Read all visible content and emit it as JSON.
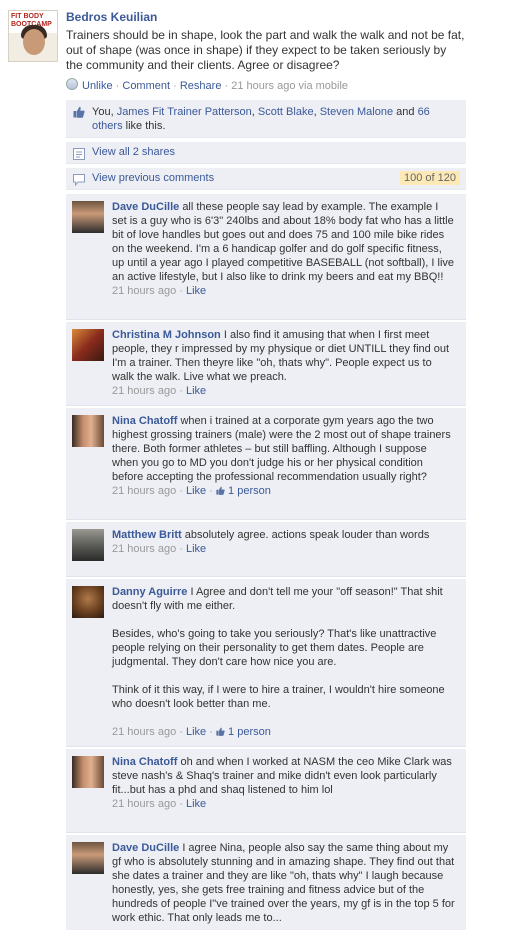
{
  "post": {
    "author": "Bedros Keuilian",
    "avatar_logo": "FIT BODY BOOTCAMP",
    "text": "Trainers should be in shape, look the part and walk the walk and not be fat, out of shape (was once in shape) if they expect to be taken seriously by the community and their clients. Agree or disagree?",
    "actions": {
      "unlike": "Unlike",
      "comment": "Comment",
      "reshare": "Reshare",
      "timestamp": "21 hours ago via mobile",
      "sep": "·"
    }
  },
  "likes": {
    "prefix": "You,",
    "people": [
      "James Fit Trainer Patterson",
      "Scott Blake",
      "Steven Malone"
    ],
    "and": "and",
    "others": "66 others",
    "suffix": "like this."
  },
  "shares": {
    "label": "View all 2 shares"
  },
  "previous": {
    "label": "View previous comments",
    "count": "100 of 120"
  },
  "comments": [
    {
      "author": "Dave DuCille",
      "text": "all these people say lead by example. The example I set is a guy who is 6'3\" 240lbs and about 18% body fat who has a little bit of love handles but goes out and does 75 and 100 mile bike rides on the weekend. I'm a 6 handicap golfer and do golf specific fitness, up until a year ago I played competitive BASEBALL (not softball), I live an active lifestyle, but I also like to drink my beers and eat my BBQ!!",
      "time": "21 hours ago",
      "like": "Like"
    },
    {
      "author": "Christina M Johnson",
      "text": "I also find it amusing that when I first meet people, they r impressed by my physique or diet UNTILL they find out I'm a trainer. Then theyre like \"oh, thats why\". People expect us to walk the walk. Live what we preach.",
      "time": "21 hours ago",
      "like": "Like"
    },
    {
      "author": "Nina Chatoff",
      "text": "when i trained at a corporate gym years ago the two highest grossing trainers (male) were the 2 most out of shape trainers there. Both former athletes – but still baffling. Although I suppose when you go to MD you don't judge his or her physical condition before accepting the professional recommendation usually right?",
      "time": "21 hours ago",
      "like": "Like",
      "likes": "1 person"
    },
    {
      "author": "Matthew Britt",
      "text": "absolutely agree. actions speak louder than words",
      "time": "21 hours ago",
      "like": "Like"
    },
    {
      "author": "Danny Aguirre",
      "text": "I Agree and don't tell me your \"off season!\" That shit doesn't fly with me either.",
      "text2": "Besides, who's going to take you seriously? That's like unattractive people relying on their personality to get them dates. People are judgmental. They don't care how nice you are.",
      "text3": "Think of it this way, if I were to hire a trainer, I wouldn't hire someone who doesn't look better than me.",
      "time": "21 hours ago",
      "like": "Like",
      "likes": "1 person"
    },
    {
      "author": "Nina Chatoff",
      "text": "oh and when I worked at NASM the ceo Mike Clark was steve nash's & Shaq's trainer and mike didn't even look particularly fit...but has a phd and shaq listened to him lol",
      "time": "21 hours ago",
      "like": "Like"
    },
    {
      "author": "Dave DuCille",
      "text": "I agree Nina, people also say the same thing about my gf who is absolutely stunning and in amazing shape. They find out that she dates a trainer and they are like \"oh, thats why\" I laugh because honestly, yes, she gets free training and fitness advice but of the hundreds of people I\"ve trained over the years, my gf is in the top 5 for work ethic. That only leads me to...",
      "time": "",
      "like": ""
    }
  ],
  "colors": {
    "link": "#3b5998",
    "ufi_bg": "#edeff4",
    "badge_bg": "#fce9b6"
  }
}
